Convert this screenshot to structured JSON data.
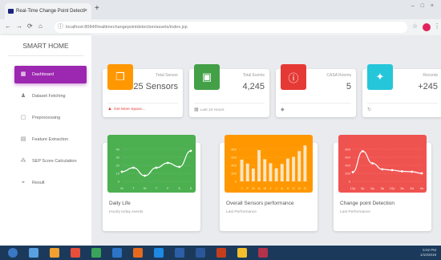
{
  "browser": {
    "tab_title": "Real-Time Change Point Detecti",
    "tab_close": "×",
    "new_tab": "+",
    "url": "localhost:8084/Realtimechangepointdetection/assets/index.jsp",
    "window_controls": "– □ ×"
  },
  "sidebar": {
    "brand": "SMART HOME",
    "items": [
      {
        "label": "Dashboard",
        "icon": "dashboard-icon",
        "active": true
      },
      {
        "label": "Dataset Fetching",
        "icon": "person-icon"
      },
      {
        "label": "Preprocessing",
        "icon": "clipboard-icon"
      },
      {
        "label": "Feature Extraction",
        "icon": "content-paste-icon"
      },
      {
        "label": "SEP Score Calculation",
        "icon": "bubble-chart-icon"
      },
      {
        "label": "Result",
        "icon": "location-icon"
      }
    ]
  },
  "stats": [
    {
      "label": "Total Sensor",
      "value": "25 Sensors",
      "footer": "Get More Space...",
      "color": "#ff9800",
      "icon": "content-copy-icon",
      "footer_icon": "warning-icon",
      "footer_color": "#e53935"
    },
    {
      "label": "Total Events",
      "value": "4,245",
      "footer": "Last 24 Hours",
      "color": "#43a047",
      "icon": "store-icon",
      "footer_icon": "date-range-icon",
      "footer_color": "#999"
    },
    {
      "label": "CASA Rooms",
      "value": "5",
      "footer": "",
      "color": "#e53935",
      "icon": "info-outline-icon",
      "footer_icon": "local-offer-icon",
      "footer_color": "#999"
    },
    {
      "label": "Records",
      "value": "+245",
      "footer": "",
      "color": "#26c6da",
      "icon": "twitter-icon",
      "footer_icon": "update-icon",
      "footer_color": "#999"
    }
  ],
  "charts": [
    {
      "title": "Daily Life",
      "subtitle": "Hourly today events",
      "color": "#4caf50"
    },
    {
      "title": "Overall Sensors performance",
      "subtitle": "Last Performance",
      "color": "#ff9800"
    },
    {
      "title": "Change point Detection",
      "subtitle": "Last Performance",
      "color": "#ef5350"
    }
  ],
  "chart_data": [
    {
      "type": "line",
      "categories": [
        "M",
        "T",
        "W",
        "T",
        "F",
        "S",
        "S"
      ],
      "values": [
        12,
        17,
        7,
        17,
        23,
        18,
        38
      ],
      "ylim": [
        0,
        50
      ],
      "yticks": [
        "0",
        "10",
        "20",
        "30",
        "40"
      ],
      "grid": true
    },
    {
      "type": "bar",
      "categories": [
        "J",
        "F",
        "M",
        "A",
        "M",
        "J",
        "J",
        "A",
        "S",
        "O",
        "N",
        "D"
      ],
      "values": [
        542,
        443,
        320,
        780,
        553,
        453,
        326,
        434,
        568,
        610,
        756,
        895
      ],
      "ylim": [
        0,
        1000
      ],
      "yticks": [
        "0",
        "200",
        "400",
        "600",
        "800"
      ],
      "grid": true
    },
    {
      "type": "line",
      "categories": [
        "12p",
        "3p",
        "6p",
        "9p",
        "12p",
        "3a",
        "6a",
        "9a"
      ],
      "values": [
        230,
        750,
        450,
        300,
        280,
        250,
        240,
        200
      ],
      "ylim": [
        0,
        1000
      ],
      "yticks": [
        "0",
        "200",
        "400",
        "600",
        "800"
      ],
      "grid": true
    }
  ],
  "taskbar": {
    "clock_time": "5:02 PM",
    "clock_date": "1/10/2019"
  }
}
